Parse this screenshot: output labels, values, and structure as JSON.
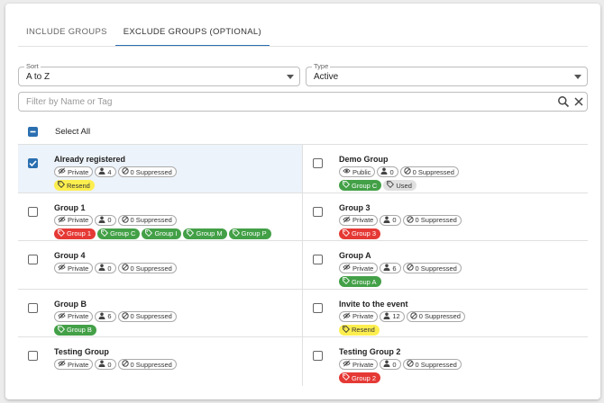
{
  "tabs": [
    {
      "label": "INCLUDE GROUPS",
      "active": false
    },
    {
      "label": "EXCLUDE GROUPS (OPTIONAL)",
      "active": true
    }
  ],
  "sort": {
    "label": "Sort",
    "value": "A to Z"
  },
  "type": {
    "label": "Type",
    "value": "Active"
  },
  "filter": {
    "placeholder": "Filter by Name or Tag"
  },
  "select_all": {
    "label": "Select All",
    "state": "indeterminate"
  },
  "colors": {
    "accent": "#2a6fb0",
    "red": "#e53935",
    "green": "#43a047",
    "yellow": "#fdee4f",
    "grey": "#e0e0e0"
  },
  "groups": [
    {
      "name": "Already registered",
      "checked": true,
      "visibility": "Private",
      "vis_icon": "eye-off-icon",
      "members": "4",
      "suppressed": "0 Suppressed",
      "tags": [
        {
          "label": "Resend",
          "color": "yellow"
        }
      ]
    },
    {
      "name": "Demo Group",
      "checked": false,
      "visibility": "Public",
      "vis_icon": "eye-icon",
      "members": "0",
      "suppressed": "0 Suppressed",
      "tags": [
        {
          "label": "Group C",
          "color": "green"
        },
        {
          "label": "Used",
          "color": "grey"
        }
      ]
    },
    {
      "name": "Group 1",
      "checked": false,
      "visibility": "Private",
      "vis_icon": "eye-off-icon",
      "members": "0",
      "suppressed": "0 Suppressed",
      "tags": [
        {
          "label": "Group 1",
          "color": "red"
        },
        {
          "label": "Group C",
          "color": "green"
        },
        {
          "label": "Group I",
          "color": "green"
        },
        {
          "label": "Group M",
          "color": "green"
        },
        {
          "label": "Group P",
          "color": "green"
        }
      ]
    },
    {
      "name": "Group 3",
      "checked": false,
      "visibility": "Private",
      "vis_icon": "eye-off-icon",
      "members": "0",
      "suppressed": "0 Suppressed",
      "tags": [
        {
          "label": "Group 3",
          "color": "red"
        }
      ]
    },
    {
      "name": "Group 4",
      "checked": false,
      "visibility": "Private",
      "vis_icon": "eye-off-icon",
      "members": "0",
      "suppressed": "0 Suppressed",
      "tags": []
    },
    {
      "name": "Group A",
      "checked": false,
      "visibility": "Private",
      "vis_icon": "eye-off-icon",
      "members": "6",
      "suppressed": "0 Suppressed",
      "tags": [
        {
          "label": "Group A",
          "color": "green"
        }
      ]
    },
    {
      "name": "Group B",
      "checked": false,
      "visibility": "Private",
      "vis_icon": "eye-off-icon",
      "members": "6",
      "suppressed": "0 Suppressed",
      "tags": [
        {
          "label": "Group B",
          "color": "green"
        }
      ]
    },
    {
      "name": "Invite to the event",
      "checked": false,
      "visibility": "Private",
      "vis_icon": "eye-off-icon",
      "members": "12",
      "suppressed": "0 Suppressed",
      "tags": [
        {
          "label": "Resend",
          "color": "yellow"
        }
      ]
    },
    {
      "name": "Testing Group",
      "checked": false,
      "visibility": "Private",
      "vis_icon": "eye-off-icon",
      "members": "0",
      "suppressed": "0 Suppressed",
      "tags": []
    },
    {
      "name": "Testing Group 2",
      "checked": false,
      "visibility": "Private",
      "vis_icon": "eye-off-icon",
      "members": "0",
      "suppressed": "0 Suppressed",
      "tags": [
        {
          "label": "Group 2",
          "color": "red"
        }
      ]
    }
  ]
}
